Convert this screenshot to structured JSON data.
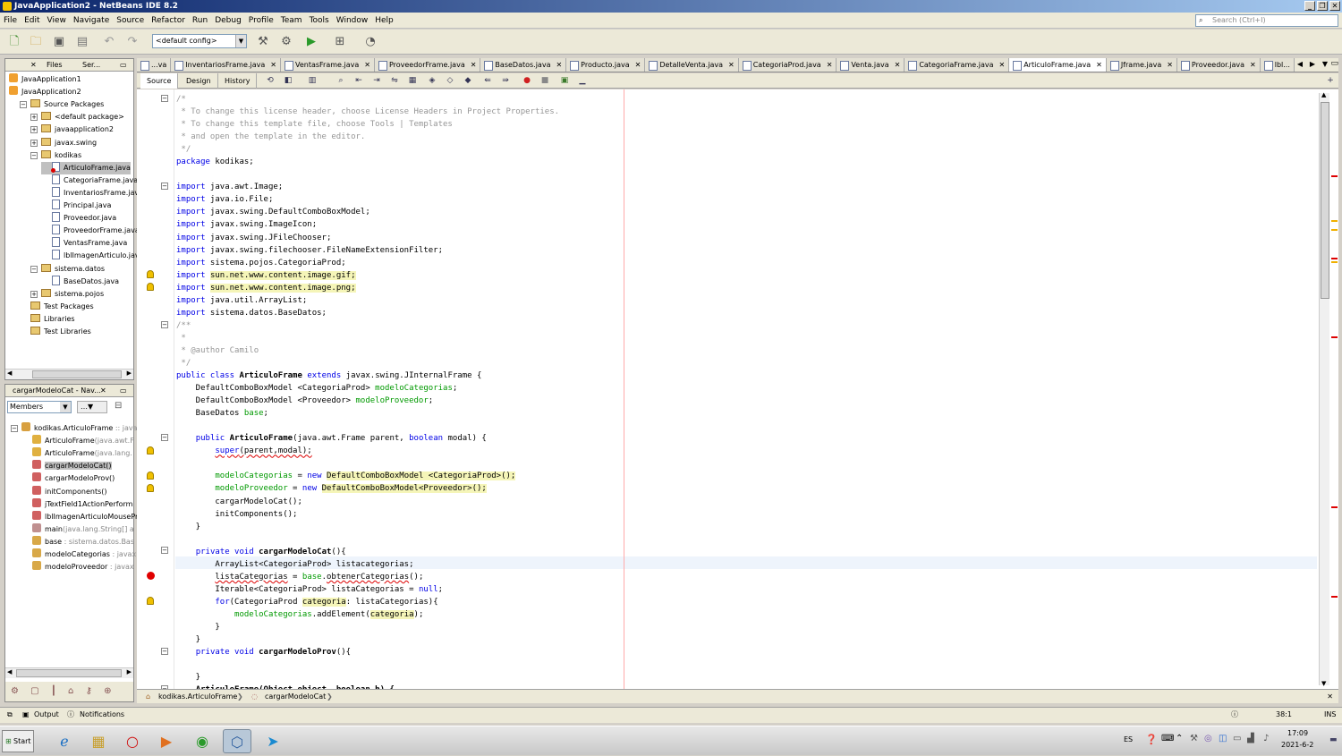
{
  "window": {
    "title": "JavaApplication2 - NetBeans IDE 8.2"
  },
  "menu": [
    "File",
    "Edit",
    "View",
    "Navigate",
    "Source",
    "Refactor",
    "Run",
    "Debug",
    "Profile",
    "Team",
    "Tools",
    "Window",
    "Help"
  ],
  "search": {
    "placeholder": "Search (Ctrl+I)"
  },
  "toolbar": {
    "config": "<default config>"
  },
  "projects_panel": {
    "tabs": [
      "Files",
      "Ser..."
    ],
    "rows": [
      {
        "label": "JavaApplication1",
        "icon": "project-icon",
        "depth": 0
      },
      {
        "label": "JavaApplication2",
        "icon": "project-icon",
        "depth": 0
      },
      {
        "label": "Source Packages",
        "icon": "folder-icon",
        "depth": 1
      },
      {
        "label": "<default package>",
        "icon": "package-icon",
        "depth": 2
      },
      {
        "label": "javaapplication2",
        "icon": "package-icon",
        "depth": 2
      },
      {
        "label": "javax.swing",
        "icon": "package-icon",
        "depth": 2
      },
      {
        "label": "kodikas",
        "icon": "package-error-icon",
        "depth": 2
      },
      {
        "label": "ArticuloFrame.java",
        "icon": "java-file-error-icon",
        "depth": 3
      },
      {
        "label": "CategoriaFrame.java",
        "icon": "java-file-icon",
        "depth": 3
      },
      {
        "label": "InventariosFrame.java",
        "icon": "java-file-icon",
        "depth": 3
      },
      {
        "label": "Principal.java",
        "icon": "java-file-icon",
        "depth": 3
      },
      {
        "label": "Proveedor.java",
        "icon": "java-file-icon",
        "depth": 3
      },
      {
        "label": "ProveedorFrame.java",
        "icon": "java-file-icon",
        "depth": 3
      },
      {
        "label": "VentasFrame.java",
        "icon": "java-file-icon",
        "depth": 3
      },
      {
        "label": "lblImagenArticulo.java",
        "icon": "java-file-icon",
        "depth": 3
      },
      {
        "label": "sistema.datos",
        "icon": "package-icon",
        "depth": 2
      },
      {
        "label": "BaseDatos.java",
        "icon": "java-file-icon",
        "depth": 3
      },
      {
        "label": "sistema.pojos",
        "icon": "package-icon",
        "depth": 2
      },
      {
        "label": "Test Packages",
        "icon": "folder-icon",
        "depth": 1
      },
      {
        "label": "Libraries",
        "icon": "folder-icon",
        "depth": 1
      },
      {
        "label": "Test Libraries",
        "icon": "folder-icon",
        "depth": 1
      }
    ]
  },
  "navigator": {
    "title": "cargarModeloCat - Nav...",
    "filter": "Members",
    "rows": [
      {
        "label": "kodikas.ArticuloFrame",
        "suffix": " :: java",
        "icon": "class-icon"
      },
      {
        "label": "ArticuloFrame",
        "suffix": "(java.awt.F",
        "icon": "constructor-icon"
      },
      {
        "label": "ArticuloFrame",
        "suffix": "(java.lang.",
        "icon": "constructor-icon"
      },
      {
        "label": "cargarModeloCat()",
        "suffix": "",
        "icon": "method-icon"
      },
      {
        "label": "cargarModeloProv()",
        "suffix": "",
        "icon": "method-icon"
      },
      {
        "label": "initComponents()",
        "suffix": "",
        "icon": "method-icon"
      },
      {
        "label": "jTextField1ActionPerform",
        "suffix": "",
        "icon": "method-icon"
      },
      {
        "label": "lblImagenArticuloMousePr",
        "suffix": "",
        "icon": "method-icon"
      },
      {
        "label": "main",
        "suffix": "(java.lang.String[] a",
        "icon": "static-method-icon"
      },
      {
        "label": "base",
        "suffix": " : sistema.datos.Bas",
        "icon": "field-icon"
      },
      {
        "label": "modeloCategorias",
        "suffix": " : javax",
        "icon": "field-icon"
      },
      {
        "label": "modeloProveedor",
        "suffix": " : javax",
        "icon": "field-icon"
      }
    ]
  },
  "editor_tabs": [
    "...va",
    "InventariosFrame.java",
    "VentasFrame.java",
    "ProveedorFrame.java",
    "BaseDatos.java",
    "Producto.java",
    "DetalleVenta.java",
    "CategoriaProd.java",
    "Venta.java",
    "CategoriaFrame.java",
    "ArticuloFrame.java",
    "Jframe.java",
    "Proveedor.java",
    "lbl..."
  ],
  "active_tab": "ArticuloFrame.java",
  "view_tabs": [
    "Source",
    "Design",
    "History"
  ],
  "code_lines": [
    [
      [
        "/*",
        "cm"
      ]
    ],
    [
      [
        " * To change this license header, choose License Headers in Project Properties.",
        "cm"
      ]
    ],
    [
      [
        " * To change this template file, choose Tools | Templates",
        "cm"
      ]
    ],
    [
      [
        " * and open the template in the editor.",
        "cm"
      ]
    ],
    [
      [
        " */",
        "cm"
      ]
    ],
    [
      [
        "package",
        "kw"
      ],
      [
        " kodikas;",
        ""
      ]
    ],
    [
      [
        "",
        ""
      ]
    ],
    [
      [
        "import",
        "kw"
      ],
      [
        " java.awt.Image;",
        ""
      ]
    ],
    [
      [
        "import",
        "kw"
      ],
      [
        " java.io.File;",
        ""
      ]
    ],
    [
      [
        "import",
        "kw"
      ],
      [
        " javax.swing.DefaultComboBoxModel;",
        ""
      ]
    ],
    [
      [
        "import",
        "kw"
      ],
      [
        " javax.swing.ImageIcon;",
        ""
      ]
    ],
    [
      [
        "import",
        "kw"
      ],
      [
        " javax.swing.JFileChooser;",
        ""
      ]
    ],
    [
      [
        "import",
        "kw"
      ],
      [
        " javax.swing.filechooser.FileNameExtensionFilter;",
        ""
      ]
    ],
    [
      [
        "import",
        "kw"
      ],
      [
        " sistema.pojos.CategoriaProd;",
        ""
      ]
    ],
    [
      [
        "import",
        "kw"
      ],
      [
        " ",
        ""
      ],
      [
        "sun.net.www.content.image.gif;",
        "hl"
      ]
    ],
    [
      [
        "import",
        "kw"
      ],
      [
        " ",
        ""
      ],
      [
        "sun.net.www.content.image.png;",
        "hl"
      ]
    ],
    [
      [
        "import",
        "kw"
      ],
      [
        " java.util.ArrayList;",
        ""
      ]
    ],
    [
      [
        "import",
        "kw"
      ],
      [
        " sistema.datos.BaseDatos;",
        ""
      ]
    ],
    [
      [
        "/**",
        "cm"
      ]
    ],
    [
      [
        " *",
        "cm"
      ]
    ],
    [
      [
        " * @author Camilo",
        "cm"
      ]
    ],
    [
      [
        " */",
        "cm"
      ]
    ],
    [
      [
        "public class",
        "kw"
      ],
      [
        " ",
        ""
      ],
      [
        "ArticuloFrame",
        "bold"
      ],
      [
        " ",
        ""
      ],
      [
        "extends",
        "kw"
      ],
      [
        " javax.swing.JInternalFrame {",
        ""
      ]
    ],
    [
      [
        "    DefaultComboBoxModel <CategoriaProd> ",
        ""
      ],
      [
        "modeloCategorias",
        "fld"
      ],
      [
        ";",
        ""
      ]
    ],
    [
      [
        "    DefaultComboBoxModel <Proveedor> ",
        ""
      ],
      [
        "modeloProveedor",
        "fld"
      ],
      [
        ";",
        ""
      ]
    ],
    [
      [
        "    BaseDatos ",
        ""
      ],
      [
        "base",
        "fld"
      ],
      [
        ";",
        ""
      ]
    ],
    [
      [
        "",
        ""
      ]
    ],
    [
      [
        "    ",
        ""
      ],
      [
        "public",
        "kw"
      ],
      [
        " ",
        ""
      ],
      [
        "ArticuloFrame",
        "bold"
      ],
      [
        "(java.awt.Frame parent, ",
        ""
      ],
      [
        "boolean",
        "kw"
      ],
      [
        " modal) {",
        ""
      ]
    ],
    [
      [
        "        ",
        ""
      ],
      [
        "super",
        "kw err"
      ],
      [
        "(parent,modal);",
        "err"
      ]
    ],
    [
      [
        "",
        ""
      ]
    ],
    [
      [
        "        ",
        ""
      ],
      [
        "modeloCategorias",
        "fld"
      ],
      [
        " = ",
        ""
      ],
      [
        "new",
        "kw"
      ],
      [
        " ",
        ""
      ],
      [
        "DefaultComboBoxModel <CategoriaProd>();",
        "hl"
      ]
    ],
    [
      [
        "        ",
        ""
      ],
      [
        "modeloProveedor",
        "fld"
      ],
      [
        " = ",
        ""
      ],
      [
        "new",
        "kw"
      ],
      [
        " ",
        ""
      ],
      [
        "DefaultComboBoxModel<Proveedor>();",
        "hl"
      ]
    ],
    [
      [
        "        cargarModeloCat();",
        ""
      ]
    ],
    [
      [
        "        initComponents();",
        ""
      ]
    ],
    [
      [
        "    }",
        ""
      ]
    ],
    [
      [
        "",
        ""
      ]
    ],
    [
      [
        "    ",
        ""
      ],
      [
        "private void",
        "kw"
      ],
      [
        " ",
        ""
      ],
      [
        "cargarModeloCat",
        "bold"
      ],
      [
        "(){",
        ""
      ]
    ],
    [
      [
        "        ArrayList<CategoriaProd> listacategorias;",
        ""
      ]
    ],
    [
      [
        "        ",
        ""
      ],
      [
        "listaCategorias",
        "err"
      ],
      [
        " = ",
        ""
      ],
      [
        "base",
        "fld"
      ],
      [
        ".",
        ""
      ],
      [
        "obtenerCategorias",
        "err"
      ],
      [
        "();",
        ""
      ]
    ],
    [
      [
        "        Iterable<CategoriaProd> listaCategorias = ",
        ""
      ],
      [
        "null",
        "kw"
      ],
      [
        ";",
        ""
      ]
    ],
    [
      [
        "        ",
        ""
      ],
      [
        "for",
        "kw"
      ],
      [
        "(CategoriaProd ",
        ""
      ],
      [
        "categoria",
        "hl"
      ],
      [
        ": listaCategorias){",
        ""
      ]
    ],
    [
      [
        "            ",
        ""
      ],
      [
        "modeloCategorias",
        "fld"
      ],
      [
        ".addElement(",
        ""
      ],
      [
        "categoria",
        "hl"
      ],
      [
        ");",
        ""
      ]
    ],
    [
      [
        "        }",
        ""
      ]
    ],
    [
      [
        "    }",
        ""
      ]
    ],
    [
      [
        "    ",
        ""
      ],
      [
        "private void",
        "kw"
      ],
      [
        " ",
        ""
      ],
      [
        "cargarModeloProv",
        "bold"
      ],
      [
        "(){",
        ""
      ]
    ],
    [
      [
        "",
        ""
      ]
    ],
    [
      [
        "    }",
        ""
      ]
    ],
    [
      [
        "    ",
        ""
      ],
      [
        "ArticuloFrame(Object object, boolean b) {",
        "bold"
      ]
    ]
  ],
  "breadcrumb": [
    "kodikas.ArticuloFrame",
    "cargarModeloCat"
  ],
  "status": {
    "output": "Output",
    "notifications": "Notifications",
    "position": "38:1",
    "mode": "INS"
  },
  "taskbar": {
    "start": "Start",
    "lang": "ES",
    "time": "17:09",
    "date": "2021-6-2"
  }
}
